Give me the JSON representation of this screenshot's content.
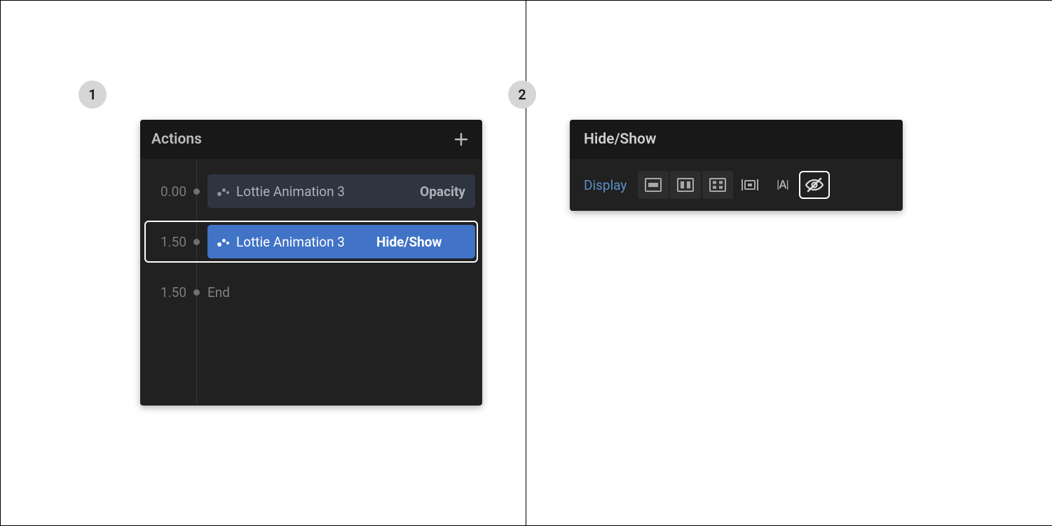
{
  "step_badges": {
    "one": "1",
    "two": "2"
  },
  "panel1": {
    "title": "Actions",
    "rows": [
      {
        "time": "0.00",
        "name": "Lottie Animation 3",
        "property": "Opacity"
      },
      {
        "time": "1.50",
        "name": "Lottie Animation 3",
        "property": "Hide/Show"
      },
      {
        "time": "1.50",
        "end_label": "End"
      }
    ]
  },
  "panel2": {
    "title": "Hide/Show",
    "property_label": "Display",
    "options": {
      "inline_block_letters": "|A|"
    }
  }
}
